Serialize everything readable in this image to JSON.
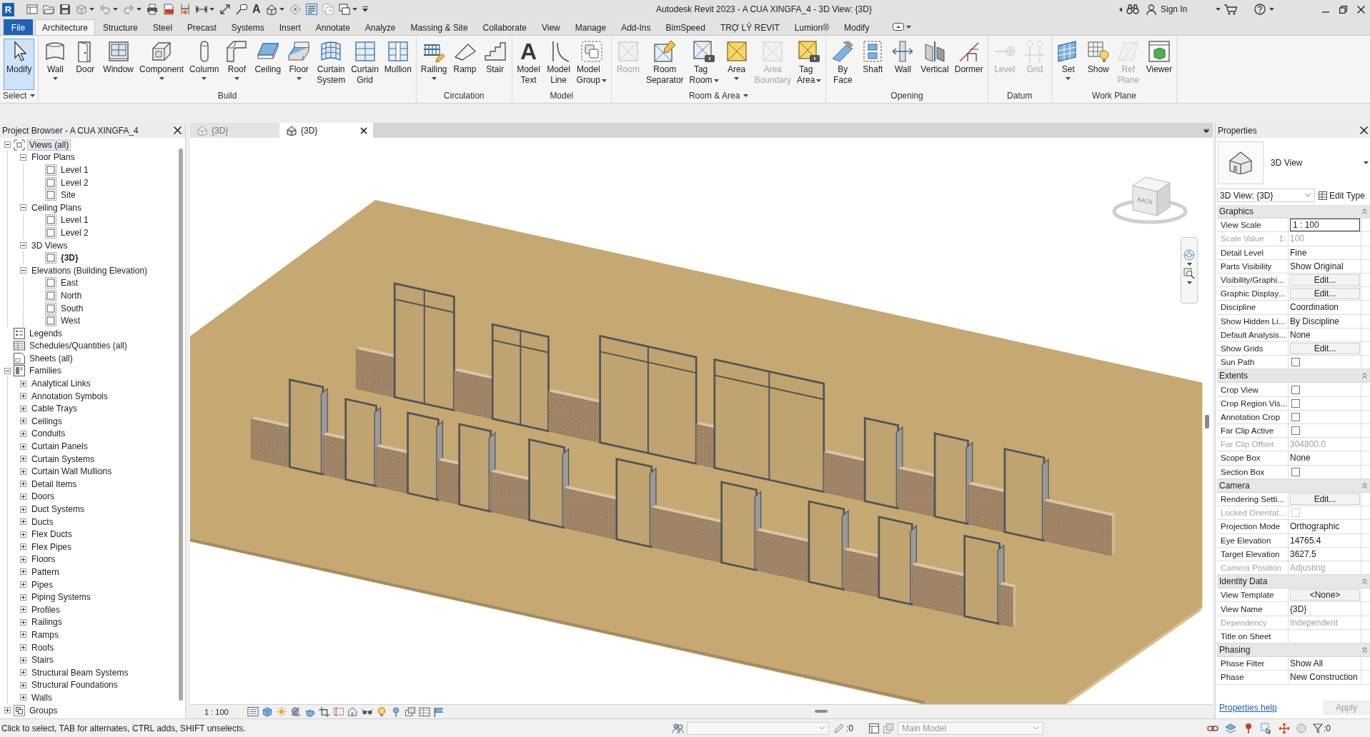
{
  "title_bar": {
    "app_letter": "R",
    "text_tool": "A",
    "title": "Autodesk Revit 2023 - A CUA XINGFA_4 - 3D View: {3D}",
    "sign_in": "Sign In"
  },
  "ribbon_tabs": [
    {
      "label": "File",
      "kind": "file",
      "selected": false
    },
    {
      "label": "Architecture",
      "kind": "tab",
      "selected": true
    },
    {
      "label": "Structure",
      "kind": "tab",
      "selected": false
    },
    {
      "label": "Steel",
      "kind": "tab",
      "selected": false
    },
    {
      "label": "Precast",
      "kind": "tab",
      "selected": false
    },
    {
      "label": "Systems",
      "kind": "tab",
      "selected": false
    },
    {
      "label": "Insert",
      "kind": "tab",
      "selected": false
    },
    {
      "label": "Annotate",
      "kind": "tab",
      "selected": false
    },
    {
      "label": "Analyze",
      "kind": "tab",
      "selected": false
    },
    {
      "label": "Massing & Site",
      "kind": "tab",
      "selected": false
    },
    {
      "label": "Collaborate",
      "kind": "tab",
      "selected": false
    },
    {
      "label": "View",
      "kind": "tab",
      "selected": false
    },
    {
      "label": "Manage",
      "kind": "tab",
      "selected": false
    },
    {
      "label": "Add-Ins",
      "kind": "tab",
      "selected": false
    },
    {
      "label": "BimSpeed",
      "kind": "tab",
      "selected": false
    },
    {
      "label": "TRỢ LÝ REVIT",
      "kind": "tab",
      "selected": false
    },
    {
      "label": "Lumion®",
      "kind": "tab",
      "selected": false
    },
    {
      "label": "Modify",
      "kind": "tab",
      "selected": false
    }
  ],
  "ribbon_panels": [
    {
      "title": "Select",
      "dropdown": true,
      "buttons": [
        {
          "label": "Modify",
          "kind": "modify",
          "dropdown": false,
          "active": true,
          "disabled": false
        }
      ]
    },
    {
      "title": "Build",
      "dropdown": false,
      "buttons": [
        {
          "label": "Wall",
          "kind": "wall",
          "dropdown": true,
          "active": false,
          "disabled": false
        },
        {
          "label": "Door",
          "kind": "door",
          "dropdown": false,
          "active": false,
          "disabled": false
        },
        {
          "label": "Window",
          "kind": "window",
          "dropdown": false,
          "active": false,
          "disabled": false
        },
        {
          "label": "Component",
          "kind": "component",
          "dropdown": true,
          "active": false,
          "disabled": false
        },
        {
          "label": "Column",
          "kind": "column",
          "dropdown": true,
          "active": false,
          "disabled": false
        },
        {
          "label": "Roof",
          "kind": "roof",
          "dropdown": true,
          "active": false,
          "disabled": false
        },
        {
          "label": "Ceiling",
          "kind": "ceiling",
          "dropdown": false,
          "active": false,
          "disabled": false
        },
        {
          "label": "Floor",
          "kind": "floor",
          "dropdown": true,
          "active": false,
          "disabled": false
        },
        {
          "label": "Curtain\nSystem",
          "kind": "curtain_system",
          "dropdown": false,
          "active": false,
          "disabled": false
        },
        {
          "label": "Curtain\nGrid",
          "kind": "curtain_grid",
          "dropdown": false,
          "active": false,
          "disabled": false
        },
        {
          "label": "Mullion",
          "kind": "mullion",
          "dropdown": false,
          "active": false,
          "disabled": false
        }
      ]
    },
    {
      "title": "Circulation",
      "dropdown": false,
      "buttons": [
        {
          "label": "Railing",
          "kind": "railing",
          "dropdown": true,
          "active": false,
          "disabled": false
        },
        {
          "label": "Ramp",
          "kind": "ramp",
          "dropdown": false,
          "active": false,
          "disabled": false
        },
        {
          "label": "Stair",
          "kind": "stair",
          "dropdown": false,
          "active": false,
          "disabled": false
        }
      ]
    },
    {
      "title": "Model",
      "dropdown": false,
      "buttons": [
        {
          "label": "Model\nText",
          "kind": "model_text",
          "glyph": "A",
          "dropdown": false,
          "active": false,
          "disabled": false
        },
        {
          "label": "Model\nLine",
          "kind": "model_line",
          "dropdown": false,
          "active": false,
          "disabled": false
        },
        {
          "label": "Model\nGroup",
          "kind": "model_group",
          "dropdown": true,
          "active": false,
          "disabled": false
        }
      ]
    },
    {
      "title": "Room & Area",
      "dropdown": true,
      "buttons": [
        {
          "label": "Room",
          "kind": "room",
          "dropdown": false,
          "active": false,
          "disabled": true
        },
        {
          "label": "Room\nSeparator",
          "kind": "room_separator",
          "dropdown": false,
          "active": false,
          "disabled": false
        },
        {
          "label": "Tag\nRoom",
          "kind": "tag_room",
          "dropdown": true,
          "active": false,
          "disabled": false
        },
        {
          "label": "Area",
          "kind": "area",
          "dropdown": true,
          "active": false,
          "disabled": false
        },
        {
          "label": "Area\nBoundary",
          "kind": "area_boundary",
          "dropdown": false,
          "active": false,
          "disabled": true
        },
        {
          "label": "Tag\nArea",
          "kind": "tag_area",
          "dropdown": true,
          "active": false,
          "disabled": false
        }
      ]
    },
    {
      "title": "Opening",
      "dropdown": false,
      "buttons": [
        {
          "label": "By\nFace",
          "kind": "by_face",
          "dropdown": false,
          "active": false,
          "disabled": false
        },
        {
          "label": "Shaft",
          "kind": "shaft",
          "dropdown": false,
          "active": false,
          "disabled": false
        },
        {
          "label": "Wall",
          "kind": "wall_opening",
          "dropdown": false,
          "active": false,
          "disabled": false
        },
        {
          "label": "Vertical",
          "kind": "vertical",
          "dropdown": false,
          "active": false,
          "disabled": false
        },
        {
          "label": "Dormer",
          "kind": "dormer",
          "dropdown": false,
          "active": false,
          "disabled": false
        }
      ]
    },
    {
      "title": "Datum",
      "dropdown": false,
      "buttons": [
        {
          "label": "Level",
          "kind": "level",
          "dropdown": false,
          "active": false,
          "disabled": true
        },
        {
          "label": "Grid",
          "kind": "grid",
          "dropdown": false,
          "active": false,
          "disabled": true
        }
      ]
    },
    {
      "title": "Work Plane",
      "dropdown": false,
      "buttons": [
        {
          "label": "Set",
          "kind": "set",
          "dropdown": true,
          "active": false,
          "disabled": false
        },
        {
          "label": "Show",
          "kind": "show",
          "dropdown": false,
          "active": false,
          "disabled": false
        },
        {
          "label": "Ref\nPlane",
          "kind": "ref_plane",
          "dropdown": false,
          "active": false,
          "disabled": true
        },
        {
          "label": "Viewer",
          "kind": "viewer",
          "dropdown": false,
          "active": false,
          "disabled": false
        }
      ]
    }
  ],
  "project_browser": {
    "title": "Project Browser - A CUA XINGFA_4",
    "tree": [
      {
        "label": "Views (all)",
        "kind": "root",
        "expanded": true,
        "selected": true,
        "children": [
          {
            "label": "Floor Plans",
            "kind": "category",
            "expanded": true,
            "selected": false,
            "children": [
              {
                "label": "Level 1",
                "kind": "view",
                "selected": false,
                "current": false
              },
              {
                "label": "Level 2",
                "kind": "view",
                "selected": false,
                "current": false
              },
              {
                "label": "Site",
                "kind": "view",
                "selected": false,
                "current": false
              }
            ]
          },
          {
            "label": "Ceiling Plans",
            "kind": "category",
            "expanded": true,
            "selected": false,
            "children": [
              {
                "label": "Level 1",
                "kind": "view",
                "selected": false,
                "current": false
              },
              {
                "label": "Level 2",
                "kind": "view",
                "selected": false,
                "current": false
              }
            ]
          },
          {
            "label": "3D Views",
            "kind": "category",
            "expanded": true,
            "selected": false,
            "children": [
              {
                "label": "{3D}",
                "kind": "view",
                "selected": false,
                "current": true
              }
            ]
          },
          {
            "label": "Elevations (Building Elevation)",
            "kind": "category",
            "expanded": true,
            "selected": false,
            "children": [
              {
                "label": "East",
                "kind": "view",
                "selected": false,
                "current": false
              },
              {
                "label": "North",
                "kind": "view",
                "selected": false,
                "current": false
              },
              {
                "label": "South",
                "kind": "view",
                "selected": false,
                "current": false
              },
              {
                "label": "West",
                "kind": "view",
                "selected": false,
                "current": false
              }
            ]
          }
        ]
      },
      {
        "label": "Legends",
        "kind": "legend",
        "selected": false
      },
      {
        "label": "Schedules/Quantities (all)",
        "kind": "schedule",
        "selected": false
      },
      {
        "label": "Sheets (all)",
        "kind": "sheet",
        "selected": false
      },
      {
        "label": "Families",
        "kind": "family",
        "expanded": true,
        "selected": false,
        "children": [
          {
            "label": "Analytical Links",
            "kind": "category",
            "expanded": false,
            "selected": false
          },
          {
            "label": "Annotation Symbols",
            "kind": "category",
            "expanded": false,
            "selected": false
          },
          {
            "label": "Cable Trays",
            "kind": "category",
            "expanded": false,
            "selected": false
          },
          {
            "label": "Ceilings",
            "kind": "category",
            "expanded": false,
            "selected": false
          },
          {
            "label": "Conduits",
            "kind": "category",
            "expanded": false,
            "selected": false
          },
          {
            "label": "Curtain Panels",
            "kind": "category",
            "expanded": false,
            "selected": false
          },
          {
            "label": "Curtain Systems",
            "kind": "category",
            "expanded": false,
            "selected": false
          },
          {
            "label": "Curtain Wall Mullions",
            "kind": "category",
            "expanded": false,
            "selected": false
          },
          {
            "label": "Detail Items",
            "kind": "category",
            "expanded": false,
            "selected": false
          },
          {
            "label": "Doors",
            "kind": "category",
            "expanded": false,
            "selected": false
          },
          {
            "label": "Duct Systems",
            "kind": "category",
            "expanded": false,
            "selected": false
          },
          {
            "label": "Ducts",
            "kind": "category",
            "expanded": false,
            "selected": false
          },
          {
            "label": "Flex Ducts",
            "kind": "category",
            "expanded": false,
            "selected": false
          },
          {
            "label": "Flex Pipes",
            "kind": "category",
            "expanded": false,
            "selected": false
          },
          {
            "label": "Floors",
            "kind": "category",
            "expanded": false,
            "selected": false
          },
          {
            "label": "Pattern",
            "kind": "category",
            "expanded": false,
            "selected": false
          },
          {
            "label": "Pipes",
            "kind": "category",
            "expanded": false,
            "selected": false
          },
          {
            "label": "Piping Systems",
            "kind": "category",
            "expanded": false,
            "selected": false
          },
          {
            "label": "Profiles",
            "kind": "category",
            "expanded": false,
            "selected": false
          },
          {
            "label": "Railings",
            "kind": "category",
            "expanded": false,
            "selected": false
          },
          {
            "label": "Ramps",
            "kind": "category",
            "expanded": false,
            "selected": false
          },
          {
            "label": "Roofs",
            "kind": "category",
            "expanded": false,
            "selected": false
          },
          {
            "label": "Stairs",
            "kind": "category",
            "expanded": false,
            "selected": false
          },
          {
            "label": "Structural Beam Systems",
            "kind": "category",
            "expanded": false,
            "selected": false
          },
          {
            "label": "Structural Foundations",
            "kind": "category",
            "expanded": false,
            "selected": false
          },
          {
            "label": "Walls",
            "kind": "category",
            "expanded": false,
            "selected": false
          }
        ]
      },
      {
        "label": "Groups",
        "kind": "group",
        "expanded": false,
        "selected": false
      }
    ]
  },
  "view": {
    "tabs": [
      {
        "label": "{3D}",
        "selected": false
      },
      {
        "label": "{3D}",
        "selected": true
      }
    ],
    "view_cube": {
      "face": "BACK"
    },
    "scale": "1 : 100"
  },
  "properties": {
    "title": "Properties",
    "type_name": "3D View",
    "instance": "3D View: {3D}",
    "edit_type": "Edit Type",
    "sections": [
      {
        "title": "Graphics",
        "expanded": true,
        "rows": [
          {
            "label": "View Scale",
            "kind": "input",
            "value": "1 : 100",
            "disabled": false
          },
          {
            "label": "Scale Value",
            "suffix": "1:",
            "kind": "text",
            "value": "100",
            "disabled": true
          },
          {
            "label": "Detail Level",
            "kind": "text",
            "value": "Fine",
            "disabled": false
          },
          {
            "label": "Parts Visibility",
            "kind": "text",
            "value": "Show Original",
            "disabled": false
          },
          {
            "label": "Visibility/Graphi...",
            "kind": "button",
            "value": "Edit...",
            "disabled": false
          },
          {
            "label": "Graphic Display...",
            "kind": "button",
            "value": "Edit...",
            "disabled": false
          },
          {
            "label": "Discipline",
            "kind": "text",
            "value": "Coordination",
            "disabled": false
          },
          {
            "label": "Show Hidden Li...",
            "kind": "text",
            "value": "By Discipline",
            "disabled": false
          },
          {
            "label": "Default Analysis...",
            "kind": "text",
            "value": "None",
            "disabled": false
          },
          {
            "label": "Show Grids",
            "kind": "button",
            "value": "Edit...",
            "disabled": false
          },
          {
            "label": "Sun Path",
            "kind": "check",
            "checked": false,
            "disabled": false
          }
        ]
      },
      {
        "title": "Extents",
        "expanded": true,
        "rows": [
          {
            "label": "Crop View",
            "kind": "check",
            "checked": false,
            "disabled": false
          },
          {
            "label": "Crop Region Vis...",
            "kind": "check",
            "checked": false,
            "disabled": false
          },
          {
            "label": "Annotation Crop",
            "kind": "check",
            "checked": false,
            "disabled": false
          },
          {
            "label": "Far Clip Active",
            "kind": "check",
            "checked": false,
            "disabled": false
          },
          {
            "label": "Far Clip Offset",
            "kind": "text",
            "value": "304800.0",
            "disabled": true
          },
          {
            "label": "Scope Box",
            "kind": "text",
            "value": "None",
            "disabled": false
          },
          {
            "label": "Section Box",
            "kind": "check",
            "checked": false,
            "disabled": false
          }
        ]
      },
      {
        "title": "Camera",
        "expanded": true,
        "rows": [
          {
            "label": "Rendering Setti...",
            "kind": "button",
            "value": "Edit...",
            "disabled": false
          },
          {
            "label": "Locked Orientat...",
            "kind": "check",
            "checked": false,
            "disabled": true
          },
          {
            "label": "Projection Mode",
            "kind": "text",
            "value": "Orthographic",
            "disabled": false
          },
          {
            "label": "Eye Elevation",
            "kind": "text",
            "value": "14765.4",
            "disabled": false
          },
          {
            "label": "Target Elevation",
            "kind": "text",
            "value": "3627.5",
            "disabled": false
          },
          {
            "label": "Camera Position",
            "kind": "text",
            "value": "Adjusting",
            "disabled": true
          }
        ]
      },
      {
        "title": "Identity Data",
        "expanded": true,
        "rows": [
          {
            "label": "View Template",
            "kind": "button",
            "value": "<None>",
            "disabled": false
          },
          {
            "label": "View Name",
            "kind": "text",
            "value": "{3D}",
            "disabled": false
          },
          {
            "label": "Dependency",
            "kind": "text",
            "value": "Independent",
            "disabled": true
          },
          {
            "label": "Title on Sheet",
            "kind": "text",
            "disabled": false
          }
        ]
      },
      {
        "title": "Phasing",
        "expanded": true,
        "rows": [
          {
            "label": "Phase Filter",
            "kind": "text",
            "value": "Show All",
            "disabled": false
          },
          {
            "label": "Phase",
            "kind": "text",
            "value": "New Construction",
            "disabled": false
          }
        ]
      }
    ],
    "help_link": "Properties help",
    "apply": {
      "label": "Apply",
      "disabled": true
    }
  },
  "status_bar": {
    "message": "Click to select, TAB for alternates, CTRL adds, SHIFT unselects.",
    "editable_count": ":0",
    "model": "Main Model",
    "filter_count": ":0"
  }
}
